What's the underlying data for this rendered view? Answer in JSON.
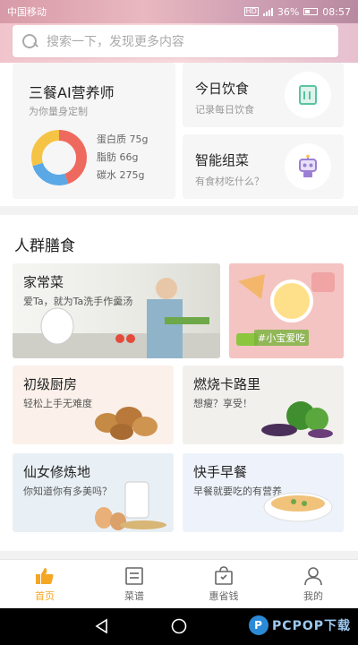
{
  "status_bar": {
    "carrier": "中国移动",
    "hd": "HD",
    "battery": "36%",
    "time": "08:57"
  },
  "search": {
    "placeholder": "搜索一下，发现更多内容"
  },
  "ai_card": {
    "title": "三餐AI营养师",
    "subtitle": "为你量身定制",
    "nutrients": [
      "蛋白质 75g",
      "脂肪 66g",
      "碳水 275g"
    ],
    "colors": {
      "protein": "#ef6a5e",
      "fat": "#f6c445",
      "carb": "#5aa8e6"
    }
  },
  "today_card": {
    "title": "今日饮食",
    "subtitle": "记录每日饮食",
    "icon": "diet-record-icon"
  },
  "combo_card": {
    "title": "智能组菜",
    "subtitle": "有食材吃什么？",
    "icon": "robot-icon"
  },
  "crowd": {
    "title": "人群膳食",
    "tiles": [
      {
        "title": "家常菜",
        "subtitle": "爱Ta，就为Ta洗手作羹汤"
      },
      {
        "title": "",
        "subtitle": "",
        "tag": "#小宝爱吃"
      },
      {
        "title": "初级厨房",
        "subtitle": "轻松上手无难度"
      },
      {
        "title": "燃烧卡路里",
        "subtitle": "想瘦？享受！"
      },
      {
        "title": "仙女修炼地",
        "subtitle": "你知道你有多美吗？"
      },
      {
        "title": "快手早餐",
        "subtitle": "早餐就要吃的有营养"
      }
    ]
  },
  "bottom_nav": [
    {
      "label": "首页",
      "icon": "thumbs-up-icon",
      "active": true
    },
    {
      "label": "菜谱",
      "icon": "recipe-book-icon",
      "active": false
    },
    {
      "label": "惠省钱",
      "icon": "shopping-bag-icon",
      "active": false
    },
    {
      "label": "我的",
      "icon": "user-icon",
      "active": false
    }
  ],
  "watermark": {
    "text": "PCPOP下载"
  },
  "accent_color": "#f5a623"
}
